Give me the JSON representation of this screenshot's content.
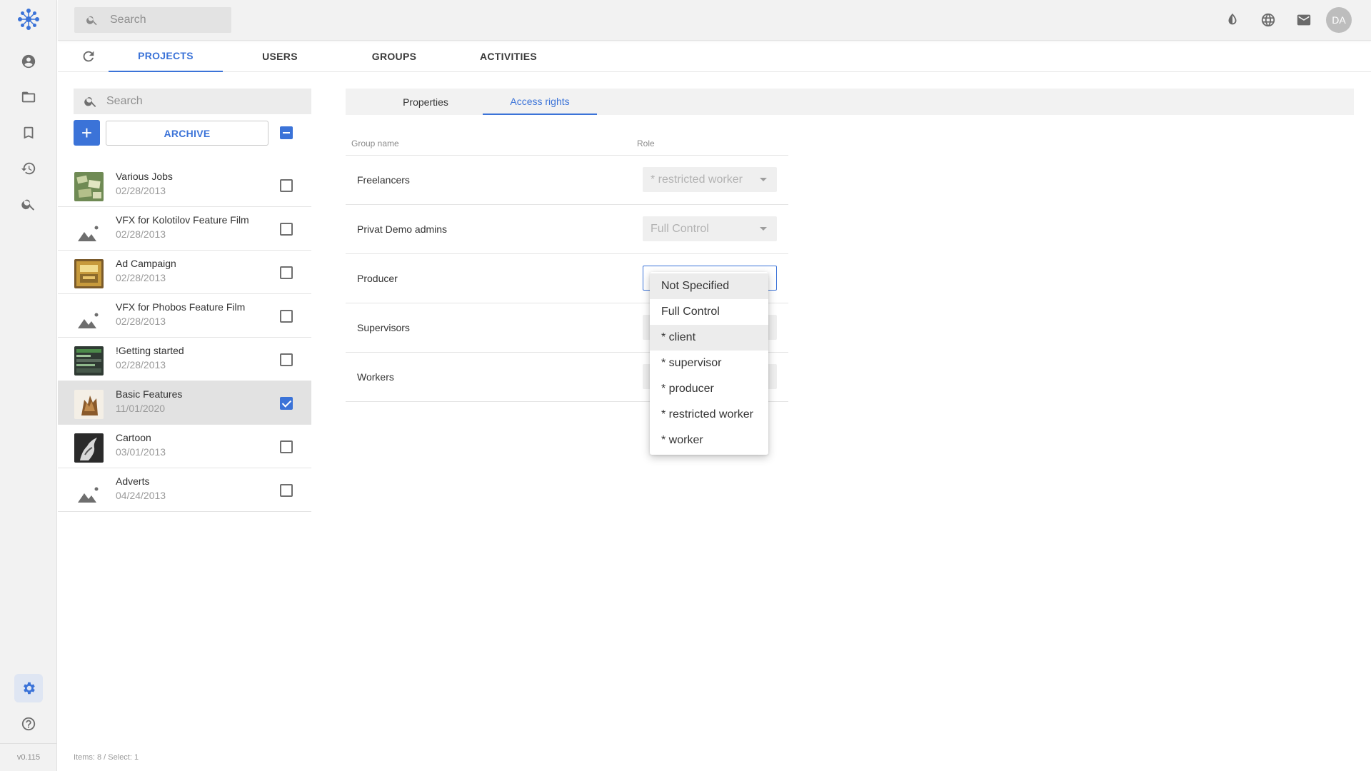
{
  "app": {
    "version": "v0.115"
  },
  "header": {
    "search_placeholder": "Search",
    "avatar_initials": "DA",
    "icons": [
      "contrast-icon",
      "globe-icon",
      "mail-icon"
    ]
  },
  "rail": {
    "items": [
      "user-icon",
      "folder-icon",
      "bookmark-icon",
      "history-icon",
      "search-icon"
    ],
    "bottom": [
      "gear-icon",
      "help-icon"
    ],
    "active": "gear-icon"
  },
  "main_tabs": [
    {
      "label": "PROJECTS",
      "active": true
    },
    {
      "label": "USERS",
      "active": false
    },
    {
      "label": "GROUPS",
      "active": false
    },
    {
      "label": "ACTIVITIES",
      "active": false
    }
  ],
  "projects_panel": {
    "search_placeholder": "Search",
    "add_label": "+",
    "archive_label": "ARCHIVE",
    "items": [
      {
        "name": "Various Jobs",
        "date": "02/28/2013",
        "checked": false
      },
      {
        "name": "VFX for Kolotilov Feature Film",
        "date": "02/28/2013",
        "checked": false
      },
      {
        "name": "Ad Campaign",
        "date": "02/28/2013",
        "checked": false
      },
      {
        "name": "VFX for Phobos Feature Film",
        "date": "02/28/2013",
        "checked": false
      },
      {
        "name": "!Getting started",
        "date": "02/28/2013",
        "checked": false
      },
      {
        "name": "Basic Features",
        "date": "11/01/2020",
        "checked": true
      },
      {
        "name": "Cartoon",
        "date": "03/01/2013",
        "checked": false
      },
      {
        "name": "Adverts",
        "date": "04/24/2013",
        "checked": false
      }
    ],
    "footer": "Items: 8 / Select: 1"
  },
  "details": {
    "tabs": [
      {
        "label": "Properties",
        "active": false
      },
      {
        "label": "Access rights",
        "active": true
      }
    ],
    "table": {
      "headers": {
        "group": "Group name",
        "role": "Role"
      },
      "rows": [
        {
          "group": "Freelancers",
          "role": "* restricted worker"
        },
        {
          "group": "Privat Demo admins",
          "role": "Full Control"
        },
        {
          "group": "Producer",
          "role": ""
        },
        {
          "group": "Supervisors",
          "role": ""
        },
        {
          "group": "Workers",
          "role": ""
        }
      ]
    },
    "role_dropdown": {
      "options": [
        "Not Specified",
        "Full Control",
        "* client",
        "* supervisor",
        "* producer",
        "* restricted worker",
        "* worker"
      ],
      "highlighted": [
        "Not Specified",
        "* client"
      ]
    }
  },
  "colors": {
    "accent": "#3b73d8",
    "rail_bg": "#f2f2f2",
    "selected_row": "#e2e2e2"
  }
}
